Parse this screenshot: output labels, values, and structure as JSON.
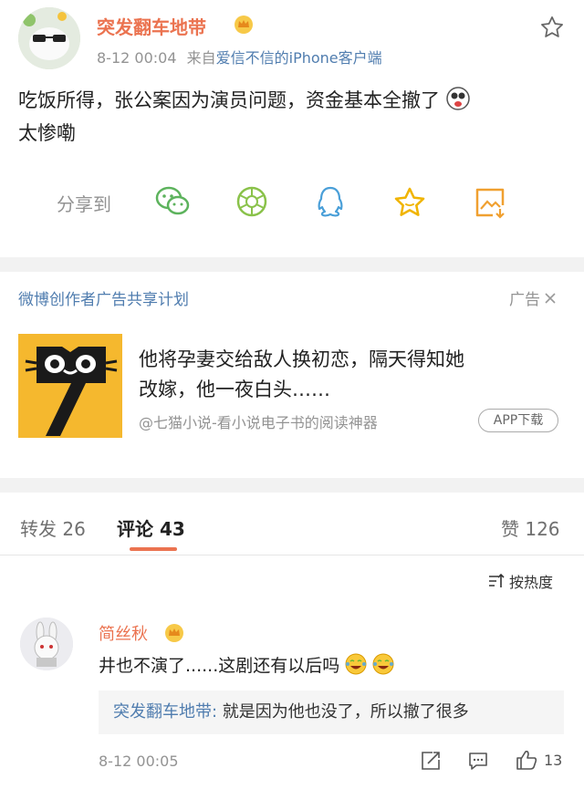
{
  "post": {
    "author": "突发翻车地带",
    "time": "8-12 00:04",
    "source_prefix": "来自",
    "source_app": "爱信不信的iPhone客户端",
    "text_line1": "吃饭所得，张公案因为演员问题，资金基本全撤了",
    "text_line2": "太惨嘞",
    "share_label": "分享到"
  },
  "ad": {
    "program": "微博创作者广告共享计划",
    "ad_tag": "广告",
    "title_line1": "他将孕妻交给敌人换初恋，隔天得知她",
    "title_line2": "改嫁，他一夜白头……",
    "source": "@七猫小说-看小说电子书的阅读神器",
    "download_label": "APP下载"
  },
  "tabs": {
    "repost_label": "转发",
    "repost_count": "26",
    "comment_label": "评论",
    "comment_count": "43",
    "like_label": "赞",
    "like_count": "126"
  },
  "sort": {
    "label": "按热度"
  },
  "comment": {
    "author": "简丝秋",
    "text": "井也不演了......这剧还有以后吗",
    "reply_author": "突发翻车地带:",
    "reply_text": " 就是因为他也没了，所以撤了很多",
    "time": "8-12 00:05",
    "like_count": "13"
  },
  "colors": {
    "accent": "#eb7350",
    "link": "#507daf",
    "ad_logo_bg": "#f5b82e"
  },
  "icons": [
    "star-icon",
    "vip-crown-icon",
    "dizzy-emoji-icon",
    "wechat-icon",
    "moments-icon",
    "qq-icon",
    "favorite-star-icon",
    "image-download-icon",
    "close-icon",
    "sort-icon",
    "repost-icon",
    "comment-icon",
    "thumbs-up-icon",
    "laugh-cry-emoji-icon"
  ]
}
